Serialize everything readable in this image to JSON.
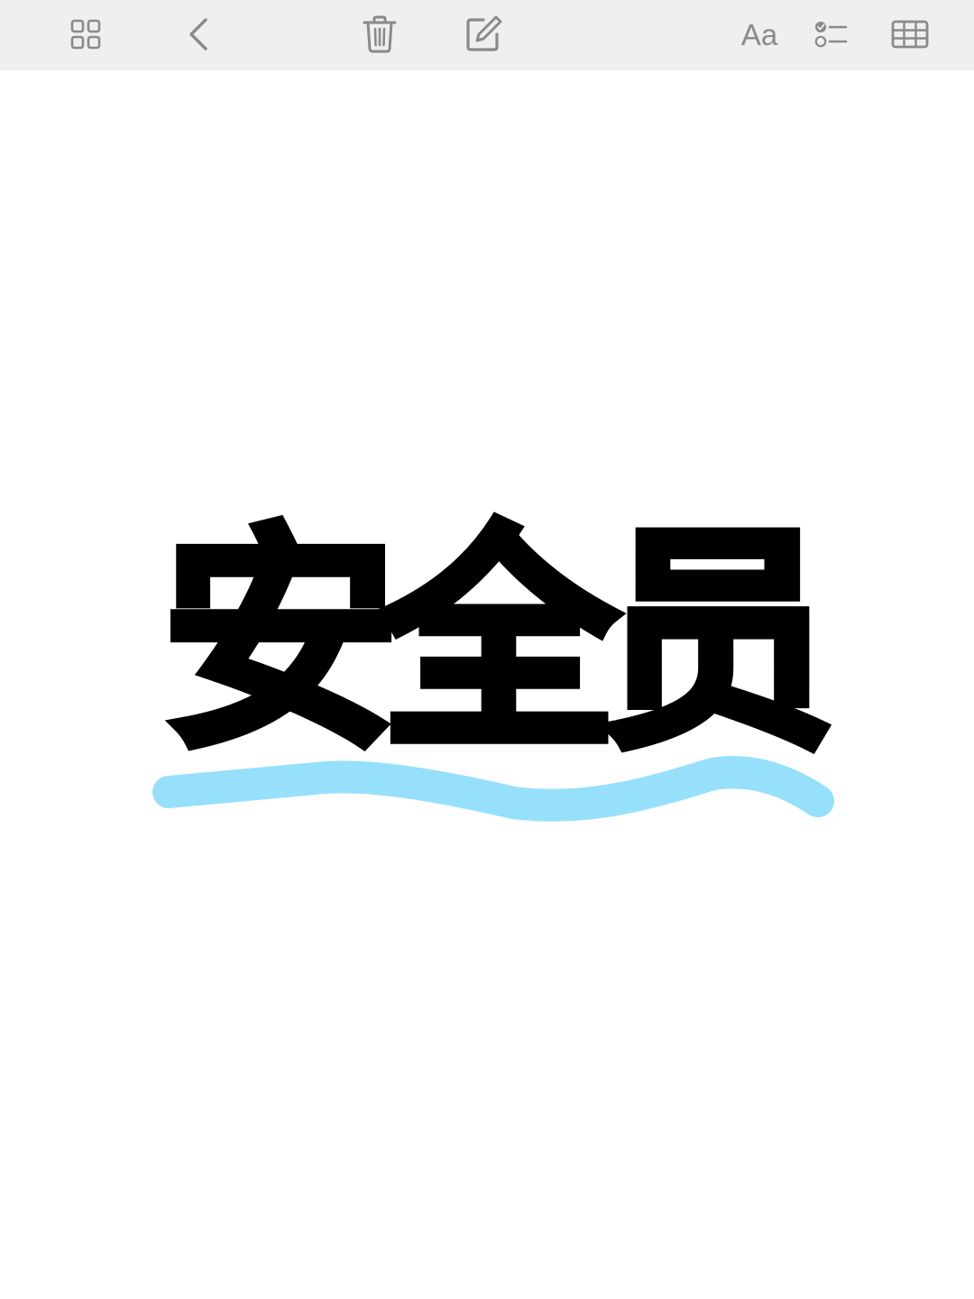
{
  "toolbar": {
    "background": "#efefef",
    "icon_color": "#8a8a8a",
    "icons": [
      "grid-icon",
      "chevron-left-icon",
      "trash-icon",
      "compose-icon",
      "format-icon",
      "checklist-icon",
      "table-icon"
    ],
    "format_label": "Aa"
  },
  "note": {
    "title_chars": [
      "安",
      "全",
      "员"
    ],
    "text_color": "#000000",
    "highlight_color": "#96e0fc"
  }
}
